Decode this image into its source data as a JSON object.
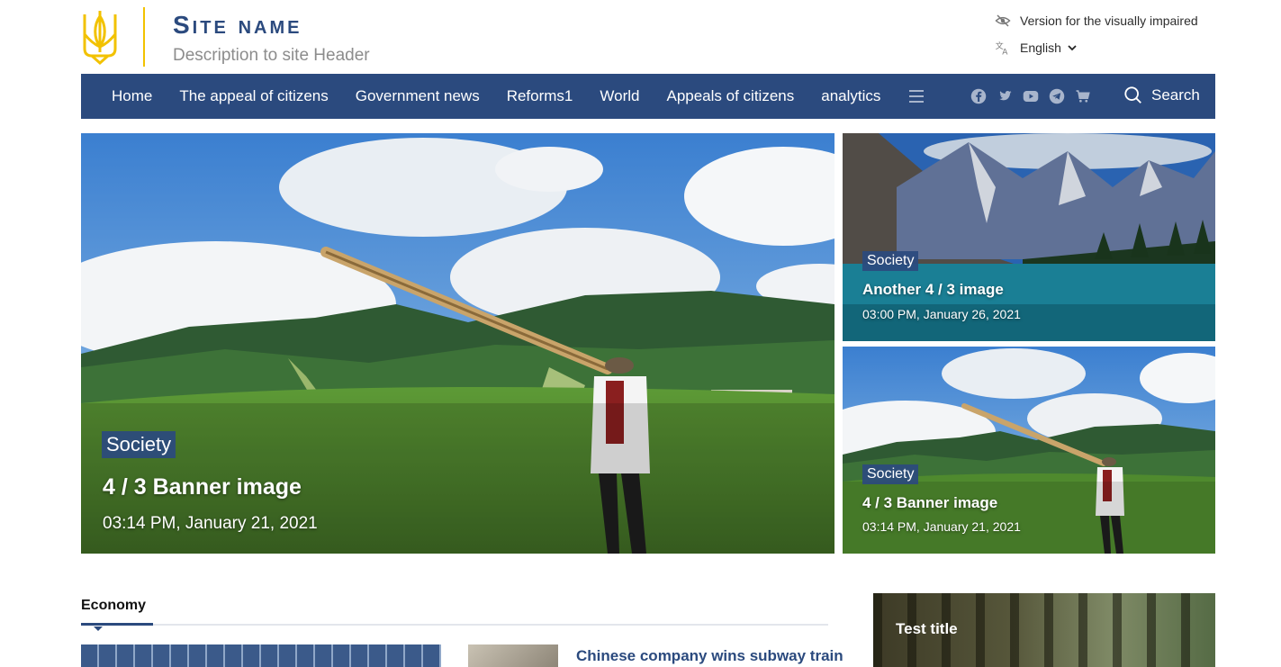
{
  "header": {
    "site_name": "Site name",
    "description": "Description to site Header",
    "accessibility_link": "Version for the visually impaired",
    "language": "English"
  },
  "nav": {
    "items": [
      "Home",
      "The appeal of citizens",
      "Government news",
      "Reforms1",
      "World",
      "Appeals of citizens",
      "analytics"
    ],
    "search_label": "Search",
    "social_icons": [
      "facebook-icon",
      "twitter-icon",
      "youtube-icon",
      "telegram-icon",
      "cart-icon"
    ]
  },
  "banners": {
    "main": {
      "tag": "Society",
      "title": "4 / 3 Banner image",
      "date": "03:14 PM, January 21, 2021"
    },
    "side1": {
      "tag": "Society",
      "title": "Another 4 / 3 image",
      "date": "03:00 PM, January 26, 2021"
    },
    "side2": {
      "tag": "Society",
      "title": "4 / 3 Banner image",
      "date": "03:14 PM, January 21, 2021"
    }
  },
  "economy": {
    "heading": "Economy",
    "article_title": "Chinese company wins subway train"
  },
  "sidebar_card": {
    "title": "Test title"
  },
  "colors": {
    "brand": "#2b4a7e",
    "accent": "#f2c200"
  }
}
